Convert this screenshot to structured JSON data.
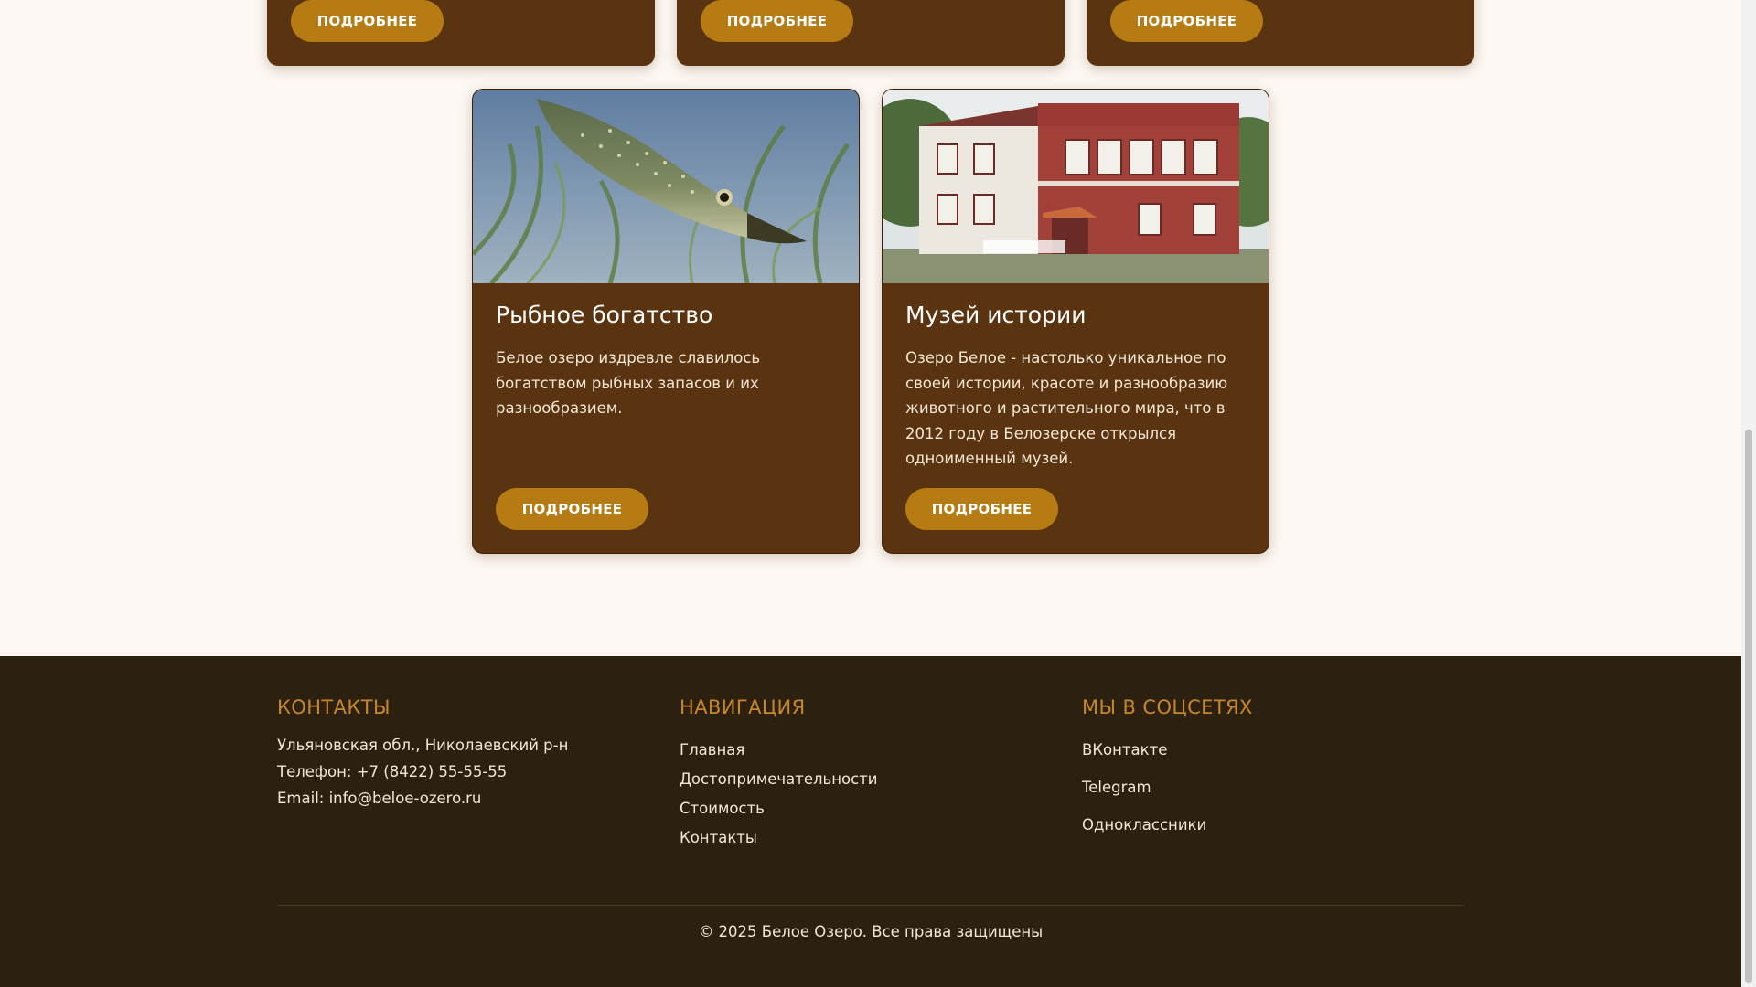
{
  "top_cards": [
    {
      "button_label": "ПОДРОБНЕЕ"
    },
    {
      "button_label": "ПОДРОБНЕЕ"
    },
    {
      "button_label": "ПОДРОБНЕЕ"
    }
  ],
  "cards": [
    {
      "title": "Рыбное богатство",
      "text": "Белое озеро издревле славилось богатством рыбных запасов и их разнообразием.",
      "button_label": "ПОДРОБНЕЕ",
      "image_icon": "pike-fish-photo"
    },
    {
      "title": "Музей истории",
      "text": "Озеро Белое - настолько уникальное по своей истории, красоте и разнообразию животного и растительного мира, что в 2012 году в Белозерске открылся одноименный музей.",
      "button_label": "ПОДРОБНЕЕ",
      "image_icon": "museum-building-photo"
    }
  ],
  "footer": {
    "contacts": {
      "heading": "КОНТАКТЫ",
      "address": "Ульяновская обл., Николаевский р-н",
      "phone": "Телефон: +7 (8422) 55-55-55",
      "email": "Email: info@beloe-ozero.ru"
    },
    "navigation": {
      "heading": "НАВИГАЦИЯ",
      "links": [
        "Главная",
        "Достопримечательности",
        "Стоимость",
        "Контакты"
      ]
    },
    "social": {
      "heading": "МЫ В СОЦСЕТЯХ",
      "links": [
        "ВКонтакте",
        "Telegram",
        "Одноклассники"
      ]
    },
    "copyright": "© 2025 Белое Озеро. Все права защищены"
  },
  "colors": {
    "page_bg": "#fdf8f3",
    "card_bg": "#5a3410",
    "button_bg": "#b77b13",
    "footer_bg": "#2c2110",
    "footer_heading": "#c7862a"
  }
}
